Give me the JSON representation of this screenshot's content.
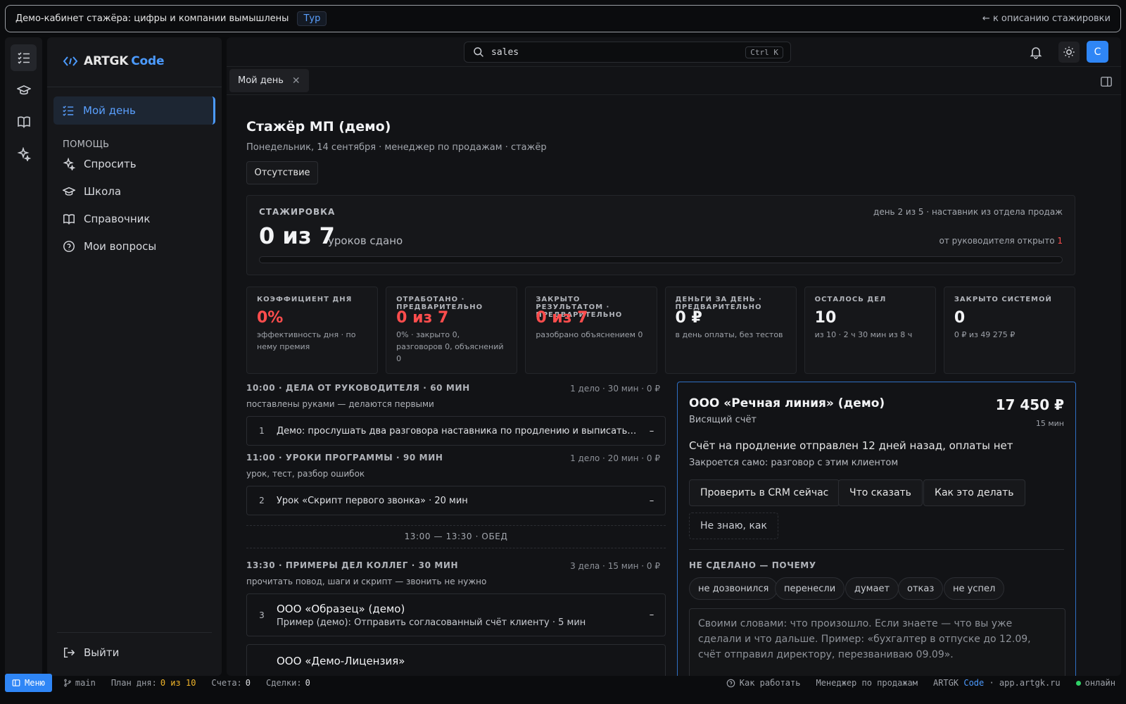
{
  "banner": {
    "text": "Демо-кабинет стажёра: цифры и компании вымышлены",
    "tour": "Тур",
    "back": "← к описанию стажировки"
  },
  "brand": {
    "name": "ARTGK",
    "suffix": "Code"
  },
  "sidebar": {
    "active": "Мой день",
    "help_header": "ПОМОЩЬ",
    "items": [
      {
        "label": "Спросить",
        "icon": "sparkle-icon"
      },
      {
        "label": "Школа",
        "icon": "graduation-cap-icon"
      },
      {
        "label": "Справочник",
        "icon": "book-icon"
      },
      {
        "label": "Мои вопросы",
        "icon": "question-circle-icon"
      }
    ],
    "logout": "Выйти"
  },
  "topbar": {
    "search_value": "sales",
    "search_shortcut": "Ctrl K",
    "avatar_letter": "С"
  },
  "tabs": [
    {
      "label": "Мой день"
    }
  ],
  "page": {
    "title": "Стажёр МП (демо)",
    "subtitle": "Понедельник, 14 сентября · менеджер по продажам · стажёр",
    "absence_button": "Отсутствие"
  },
  "internship": {
    "label": "СТАЖИРОВКА",
    "value": "0 из 7",
    "value_sub": "уроков сдано",
    "right_top": "день 2 из 5 · наставник из отдела продаж",
    "right_bottom": "от руководителя открыто",
    "open_count": "1",
    "progress": 0
  },
  "stats": [
    {
      "label": "КОЭФФИЦИЕНТ ДНЯ",
      "value": "0%",
      "desc": "эффективность дня · по нему премия",
      "red": true
    },
    {
      "label": "ОТРАБОТАНО · ПРЕДВАРИТЕЛЬНО",
      "value": "0 из 7",
      "desc": "0% · закрыто 0, разговоров 0, объяснений 0",
      "red": true
    },
    {
      "label": "ЗАКРЫТО РЕЗУЛЬТАТОМ · ПРЕДВАРИТЕЛЬНО",
      "value": "0 из 7",
      "desc": "разобрано объяснением 0",
      "red": true
    },
    {
      "label": "ДЕНЬГИ ЗА ДЕНЬ · ПРЕДВАРИТЕЛЬНО",
      "value": "0 ₽",
      "desc": "в день оплаты, без тестов",
      "red": false
    },
    {
      "label": "ОСТАЛОСЬ ДЕЛ",
      "value": "10",
      "desc": "из 10 · 2 ч 30 мин из 8 ч",
      "red": false
    },
    {
      "label": "ЗАКРЫТО СИСТЕМОЙ",
      "value": "0",
      "desc": "0 ₽ из 49 275 ₽",
      "red": false
    }
  ],
  "sections": [
    {
      "heading": "10:00 · ДЕЛА ОТ РУКОВОДИТЕЛЯ · 60 МИН",
      "meta": "1 дело · 30 мин · 0 ₽",
      "sub": "поставлены руками — делаются первыми"
    },
    {
      "heading": "11:00 · УРОКИ ПРОГРАММЫ · 90 МИН",
      "meta": "1 дело · 20 мин · 0 ₽",
      "sub": "урок, тест, разбор ошибок"
    },
    {
      "heading": "13:30 · ПРИМЕРЫ ДЕЛ КОЛЛЕГ · 30 МИН",
      "meta": "3 дела · 15 мин · 0 ₽",
      "sub": "прочитать повод, шаги и скрипт — звонить не нужно"
    }
  ],
  "tasks": [
    {
      "num": "1",
      "text": "Демо: прослушать два разговора наставника по продлению и выписать, как он на...",
      "mark": "–"
    },
    {
      "num": "2",
      "text": "Урок «Скрипт первого звонка» · 20 мин",
      "mark": "–"
    },
    {
      "num": "3",
      "title": "ООО «Образец» (демо)",
      "text": "Пример (демо): Отправить согласованный счёт клиенту · 5 мин",
      "mark": "–"
    },
    {
      "num": "",
      "title": "ООО «Демо-Лицензия»",
      "text": "",
      "mark": ""
    }
  ],
  "lunch": "13:00 — 13:30 · ОБЕД",
  "card": {
    "title": "ООО «Речная линия» (демо)",
    "subtitle": "Висящий счёт",
    "amount": "17 450 ₽",
    "duration": "15 мин",
    "desc": "Счёт на продление отправлен 12 дней назад, оплаты нет",
    "desc2": "Закроется само: разговор с этим клиентом",
    "buttons": [
      "Проверить в CRM сейчас",
      "Что сказать",
      "Как это делать",
      "Не знаю, как"
    ],
    "not_done": "НЕ СДЕЛАНО — ПОЧЕМУ",
    "reasons": [
      "не дозвонился",
      "перенесли",
      "думает",
      "отказ",
      "не успел"
    ],
    "placeholder": "Своими словами: что произошло. Если знаете — что вы уже сделали и что дальше. Пример: «бухгалтер в отпуске до 12.09, счёт отправил директору, перезваниваю 09.09»."
  },
  "statusbar": {
    "menu": "Меню",
    "branch": "main",
    "plan_label": "План дня:",
    "plan_value": "0 из 10",
    "invoices_label": "Счета:",
    "invoices_value": "0",
    "deals_label": "Сделки:",
    "deals_value": "0",
    "how": "Как работать",
    "role": "Менеджер по продажам",
    "brand": "ARTGK",
    "brand_code": "Code",
    "domain": "· app.artgk.ru",
    "online": "онлайн"
  }
}
